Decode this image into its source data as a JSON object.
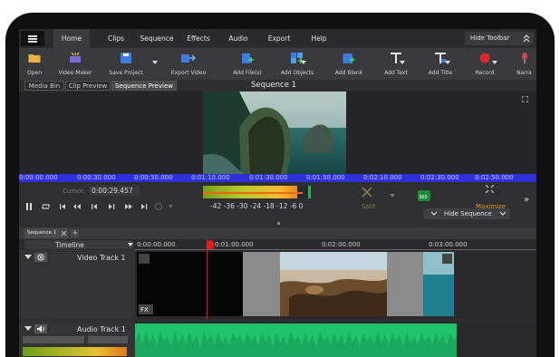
{
  "menu": {
    "items": [
      {
        "label": "Home",
        "active": true
      },
      {
        "label": "Clips"
      },
      {
        "label": "Sequence"
      },
      {
        "label": "Effects"
      },
      {
        "label": "Audio"
      },
      {
        "label": "Export"
      },
      {
        "label": "Help"
      }
    ],
    "hide_toolbar": "Hide Toolbar"
  },
  "toolbar": {
    "open": "Open",
    "video_maker": "Video Maker",
    "save_project": "Save Project",
    "export_video": "Export Video",
    "add_files": "Add File(s)",
    "add_objects": "Add Objects",
    "add_blank": "Add Blank",
    "add_text": "Add Text",
    "add_title": "Add Title",
    "record": "Record",
    "narrate": "Narra"
  },
  "tabs": {
    "media_bin": "Media Bin",
    "clip_preview": "Clip Preview",
    "sequence_preview": "Sequence Preview",
    "title": "Sequence 1"
  },
  "preview_ruler": [
    "0:00:00.000",
    "0:00:30.000",
    "0:00:50.000",
    "0:01:10.000",
    "0:01:30.000",
    "0:01:50.000",
    "0:02:10.000",
    "0:02:30.000",
    "0:02:50.000"
  ],
  "controls": {
    "cursor_label": "Cursor:",
    "cursor_value": "0:00:29.457",
    "meter_scale": "-42 -36 -30 -24 -18 -12  -6  0",
    "split": "Split",
    "deg_360": "360",
    "maximize": "Maximize",
    "hide_sequence": "Hide Sequence",
    "overflow": "»"
  },
  "sequence_tab": {
    "label": "Sequence 1",
    "add": "+"
  },
  "timeline": {
    "label": "Timeline",
    "ruler": [
      "0:00:00.000",
      "0:01:00.000",
      "0:02:00.000",
      "0:03:00.000"
    ]
  },
  "tracks": {
    "video": "Video Track 1",
    "audio": "Audio Track 1",
    "fx": "FX"
  },
  "colors": {
    "accent_green": "#1fc46a",
    "playhead": "#e11c1c",
    "ruler_blue": "#2e31d8",
    "maximize_orange": "#e59a2a"
  }
}
